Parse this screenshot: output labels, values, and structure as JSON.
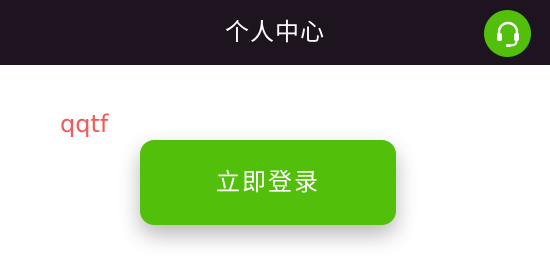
{
  "header": {
    "title": "个人中心",
    "support_icon": "headset-icon",
    "background_color": "#1d1420"
  },
  "user": {
    "username": "qqtf",
    "username_color": "#f25a5a"
  },
  "login": {
    "button_label": "立即登录",
    "button_color": "#52bf0b"
  }
}
